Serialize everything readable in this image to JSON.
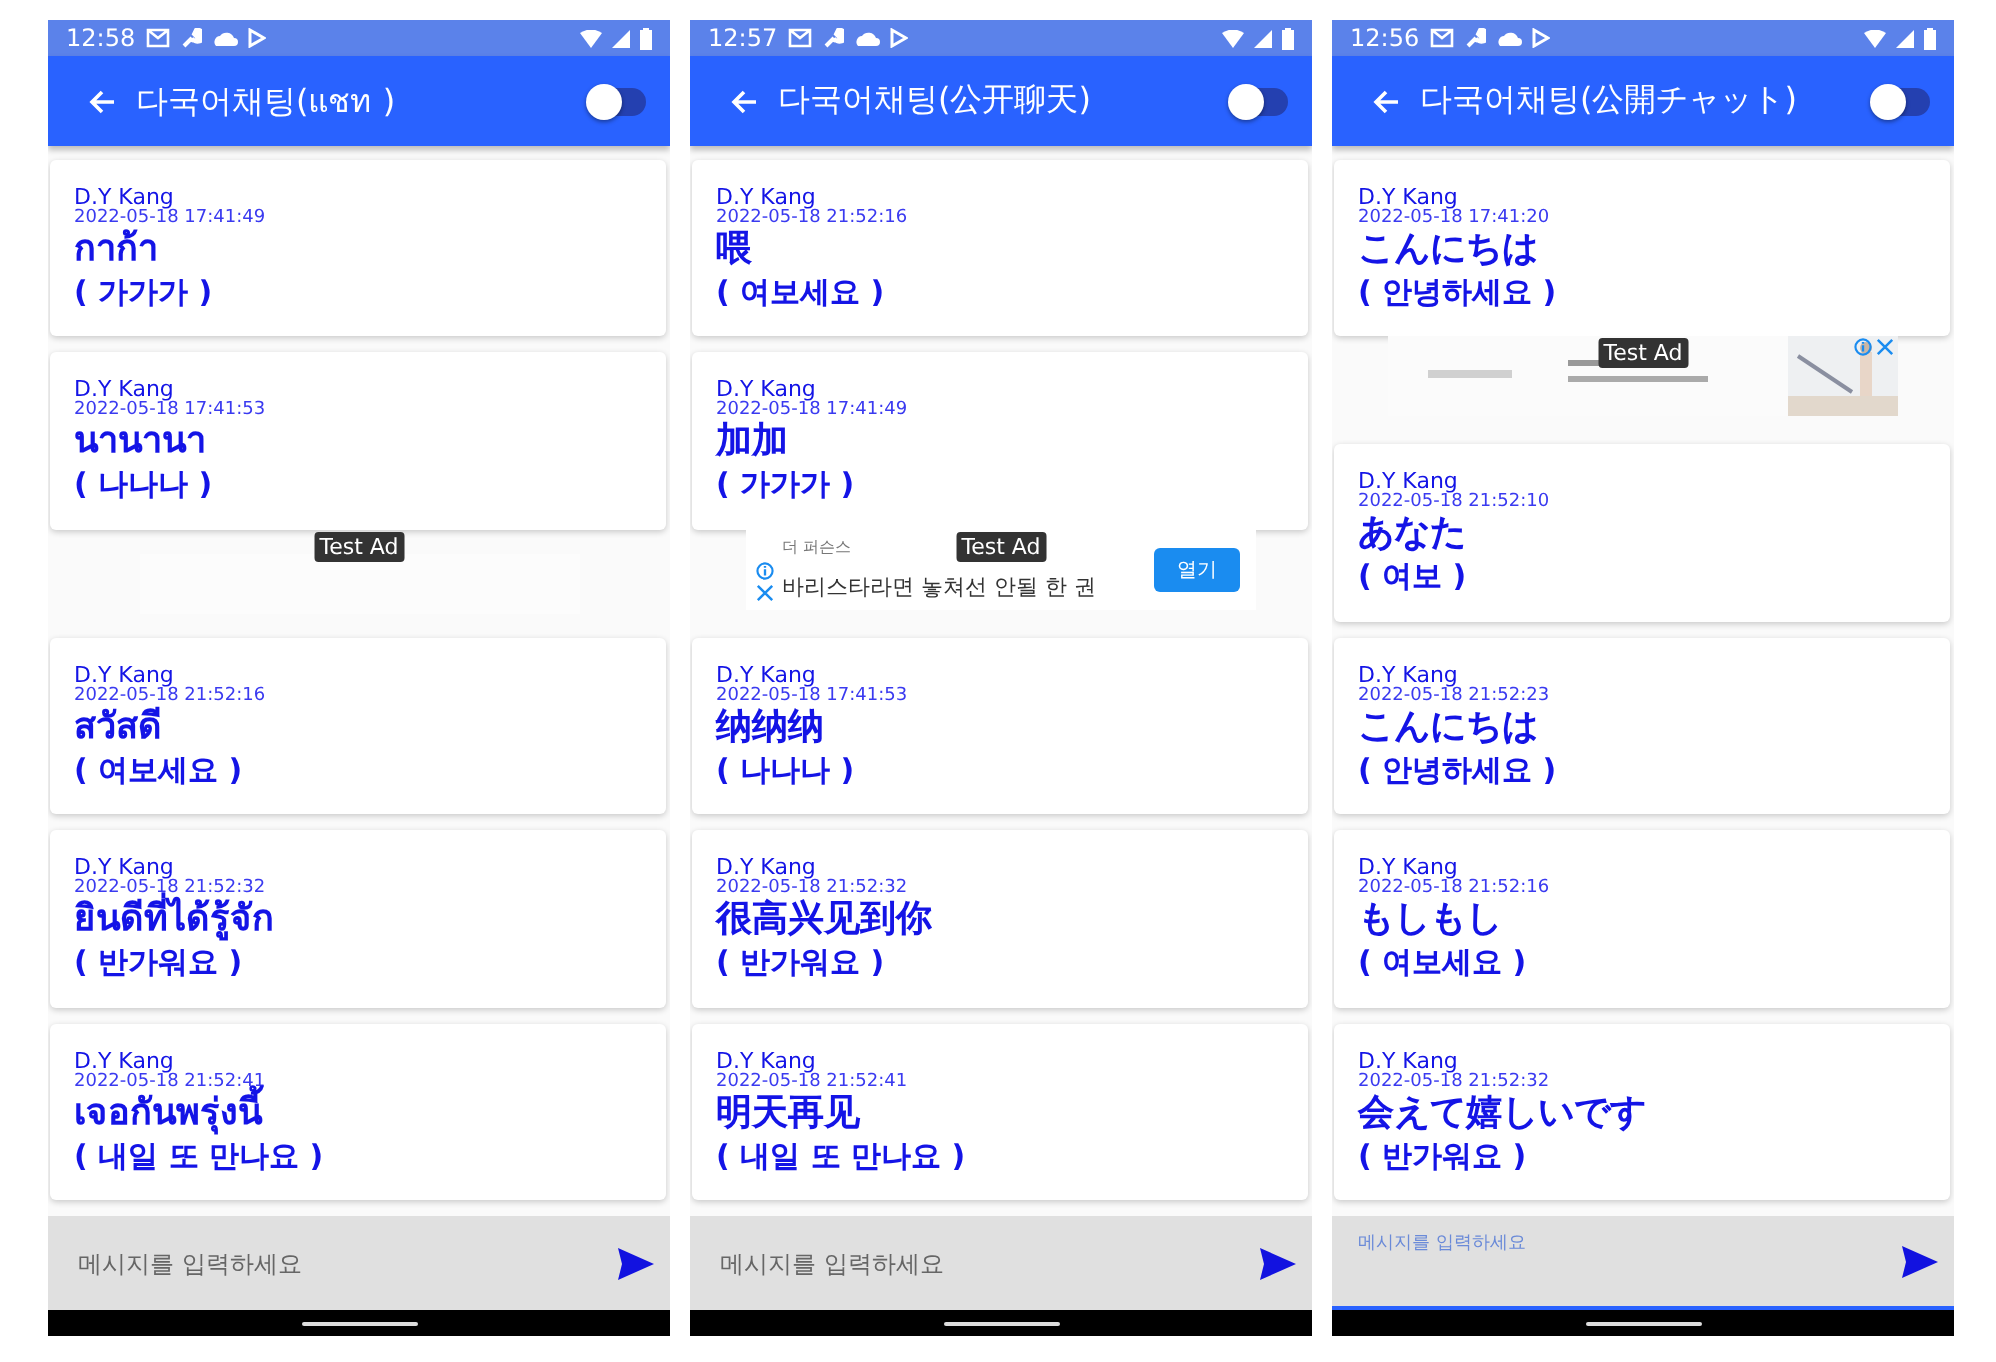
{
  "screens": [
    {
      "status_time": "12:58",
      "title": "다국어채팅(แชท )",
      "toggle": {
        "on": false
      },
      "items": [
        {
          "kind": "message",
          "sender": "D.Y Kang",
          "time": "2022-05-18 17:41:49",
          "text": "กาก้า",
          "translation": "( 가가가 )"
        },
        {
          "kind": "message",
          "sender": "D.Y Kang",
          "time": "2022-05-18 17:41:53",
          "text": "นานานา",
          "translation": "( 나나나 )"
        },
        {
          "kind": "emptyad",
          "label": "Test Ad"
        },
        {
          "kind": "message",
          "sender": "D.Y Kang",
          "time": "2022-05-18 21:52:16",
          "text": "สวัสดี",
          "translation": "( 여보세요 )"
        },
        {
          "kind": "message",
          "sender": "D.Y Kang",
          "time": "2022-05-18 21:52:32",
          "text": "ยินดีที่ได้รู้จัก",
          "translation": "( 반가워요 )"
        },
        {
          "kind": "message",
          "sender": "D.Y Kang",
          "time": "2022-05-18 21:52:41",
          "text": "เจอกันพรุ่งนี้",
          "translation": "( 내일 또 만나요 )"
        }
      ],
      "input": {
        "placeholder": "메시지를 입력하세요",
        "focused": false
      }
    },
    {
      "status_time": "12:57",
      "title": "다국어채팅(公开聊天)",
      "toggle": {
        "on": false
      },
      "items": [
        {
          "kind": "message",
          "sender": "D.Y Kang",
          "time": "2022-05-18 21:52:16",
          "text": "喂",
          "translation": "( 여보세요 )"
        },
        {
          "kind": "message",
          "sender": "D.Y Kang",
          "time": "2022-05-18 17:41:49",
          "text": "加加",
          "translation": "( 가가가 )"
        },
        {
          "kind": "textad",
          "label": "Test Ad",
          "advertiser": "더 퍼슨스",
          "headline": "바리스타라면 놓쳐선 안될 한 권",
          "button": "열기"
        },
        {
          "kind": "message",
          "sender": "D.Y Kang",
          "time": "2022-05-18 17:41:53",
          "text": "纳纳纳",
          "translation": "( 나나나 )"
        },
        {
          "kind": "message",
          "sender": "D.Y Kang",
          "time": "2022-05-18 21:52:32",
          "text": "很高兴见到你",
          "translation": "( 반가워요 )"
        },
        {
          "kind": "message",
          "sender": "D.Y Kang",
          "time": "2022-05-18 21:52:41",
          "text": "明天再见",
          "translation": "( 내일 또 만나요 )"
        }
      ],
      "input": {
        "placeholder": "메시지를 입력하세요",
        "focused": false
      }
    },
    {
      "status_time": "12:56",
      "title": "다국어채팅(公開チャット)",
      "toggle": {
        "on": false
      },
      "items": [
        {
          "kind": "message",
          "sender": "D.Y Kang",
          "time": "2022-05-18 17:41:20",
          "text": "こんにちは",
          "translation": "( 안녕하세요 )"
        },
        {
          "kind": "bannerad",
          "label": "Test Ad"
        },
        {
          "kind": "message",
          "sender": "D.Y Kang",
          "time": "2022-05-18 21:52:10",
          "text": "あなた",
          "translation": "( 여보 )"
        },
        {
          "kind": "message",
          "sender": "D.Y Kang",
          "time": "2022-05-18 21:52:23",
          "text": "こんにちは",
          "translation": "( 안녕하세요 )"
        },
        {
          "kind": "message",
          "sender": "D.Y Kang",
          "time": "2022-05-18 21:52:16",
          "text": "もしもし",
          "translation": "( 여보세요 )"
        },
        {
          "kind": "message",
          "sender": "D.Y Kang",
          "time": "2022-05-18 21:52:32",
          "text": "会えて嬉しいです",
          "translation": "( 반가워요 )"
        }
      ],
      "input": {
        "placeholder": "메시지를 입력하세요",
        "focused": true
      }
    }
  ]
}
